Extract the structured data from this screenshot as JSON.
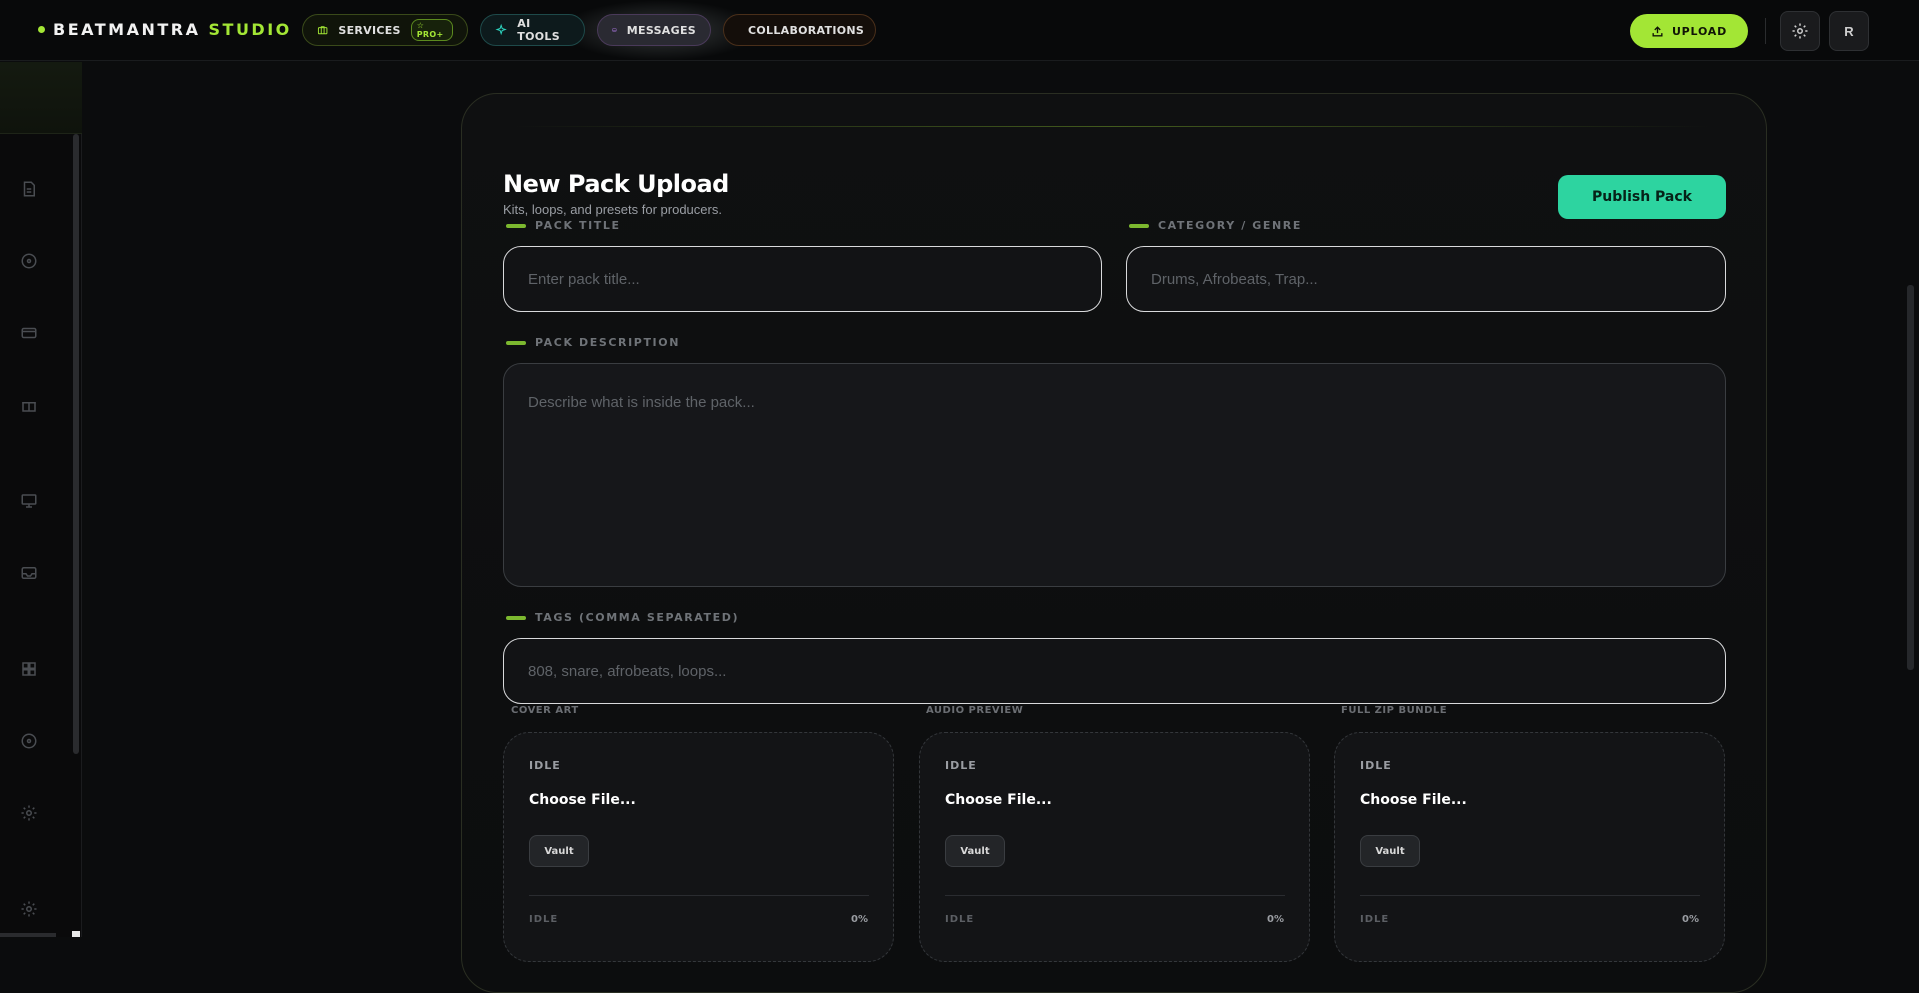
{
  "brand": {
    "name": "BEATMANTRA",
    "suffix": "STUDIO"
  },
  "nav": {
    "services": {
      "label": "SERVICES",
      "badge": "PRO+"
    },
    "ai_tools": {
      "label": "AI TOOLS"
    },
    "messages": {
      "label": "MESSAGES"
    },
    "collaborations": {
      "label": "COLLABORATIONS"
    }
  },
  "header": {
    "upload_label": "UPLOAD",
    "avatar_initial": "R"
  },
  "sidebar": {
    "icons": [
      "document-icon",
      "disc-icon",
      "card-icon",
      "gift-icon",
      "monitor-icon",
      "inbox-icon",
      "grid-icon",
      "disc-icon",
      "gear-icon",
      "gear-icon"
    ]
  },
  "form": {
    "title": "New Pack Upload",
    "subtitle": "Kits, loops, and presets for producers.",
    "publish_label": "Publish Pack",
    "pack_title": {
      "label": "PACK TITLE",
      "placeholder": "Enter pack title..."
    },
    "category": {
      "label": "CATEGORY / GENRE",
      "placeholder": "Drums, Afrobeats, Trap..."
    },
    "description": {
      "label": "PACK DESCRIPTION",
      "placeholder": "Describe what is inside the pack..."
    },
    "tags": {
      "label": "TAGS (COMMA SEPARATED)",
      "placeholder": "808, snare, afrobeats, loops..."
    }
  },
  "uploads": [
    {
      "label": "COVER ART",
      "status": "IDLE",
      "choose": "Choose File...",
      "vault": "Vault",
      "progress_status": "IDLE",
      "progress": "0%"
    },
    {
      "label": "AUDIO PREVIEW",
      "status": "IDLE",
      "choose": "Choose File...",
      "vault": "Vault",
      "progress_status": "IDLE",
      "progress": "0%"
    },
    {
      "label": "FULL ZIP BUNDLE",
      "status": "IDLE",
      "choose": "Choose File...",
      "vault": "Vault",
      "progress_status": "IDLE",
      "progress": "0%"
    }
  ],
  "colors": {
    "accent": "#a3e635",
    "publish": "#2dd4a0",
    "background": "#0b0c0d"
  }
}
